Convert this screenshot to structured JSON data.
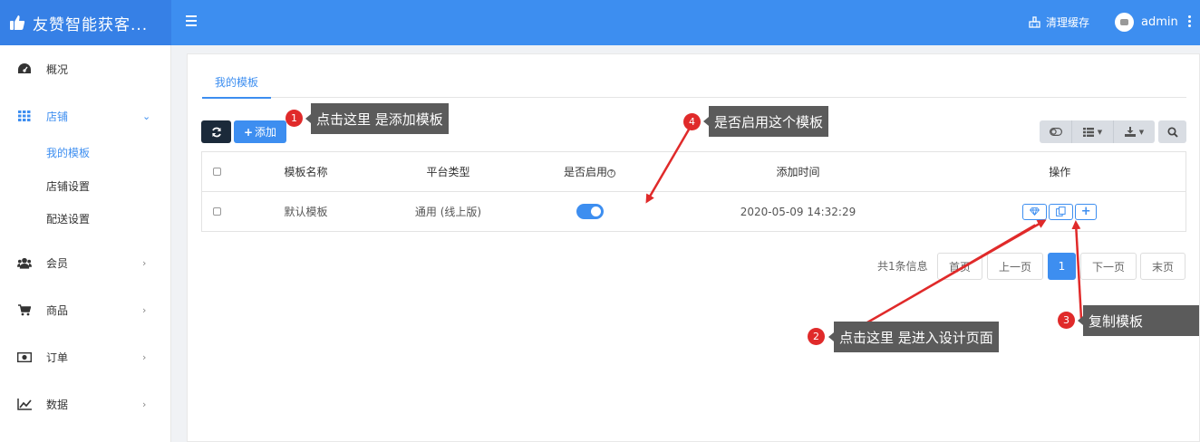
{
  "app": {
    "title": "友赞智能获客..."
  },
  "header": {
    "clear_cache": "清理缓存",
    "user": "admin"
  },
  "sidebar": {
    "items": [
      {
        "label": "概况",
        "icon": "dashboard-icon"
      },
      {
        "label": "店铺",
        "icon": "grid-icon",
        "chevron": "⌄"
      },
      {
        "label": "会员",
        "icon": "users-icon",
        "chevron": "›"
      },
      {
        "label": "商品",
        "icon": "cart-icon",
        "chevron": "›"
      },
      {
        "label": "订单",
        "icon": "money-icon",
        "chevron": "›"
      },
      {
        "label": "数据",
        "icon": "chart-icon",
        "chevron": "›"
      }
    ],
    "subitems": [
      {
        "label": "我的模板",
        "active": true
      },
      {
        "label": "店铺设置"
      },
      {
        "label": "配送设置"
      }
    ]
  },
  "main": {
    "tab": "我的模板",
    "add_button": "添加",
    "table": {
      "columns": [
        "模板名称",
        "平台类型",
        "是否启用",
        "添加时间",
        "操作"
      ],
      "rows": [
        {
          "name": "默认模板",
          "platform": "通用 (线上版)",
          "enabled": true,
          "time": "2020-05-09 14:32:29"
        }
      ]
    },
    "pager": {
      "info": "共1条信息",
      "first": "首页",
      "prev": "上一页",
      "current": "1",
      "next": "下一页",
      "last": "末页"
    }
  },
  "annotations": [
    {
      "num": "1",
      "text": "点击这里 是添加模板"
    },
    {
      "num": "2",
      "text": "点击这里 是进入设计页面"
    },
    {
      "num": "3",
      "text": "复制模板"
    },
    {
      "num": "4",
      "text": "是否启用这个模板"
    }
  ],
  "colors": {
    "primary": "#3d8ef0",
    "dark_button": "#1b2a3a",
    "annotation": "#e02a2a",
    "callout": "#5b5b5b"
  }
}
